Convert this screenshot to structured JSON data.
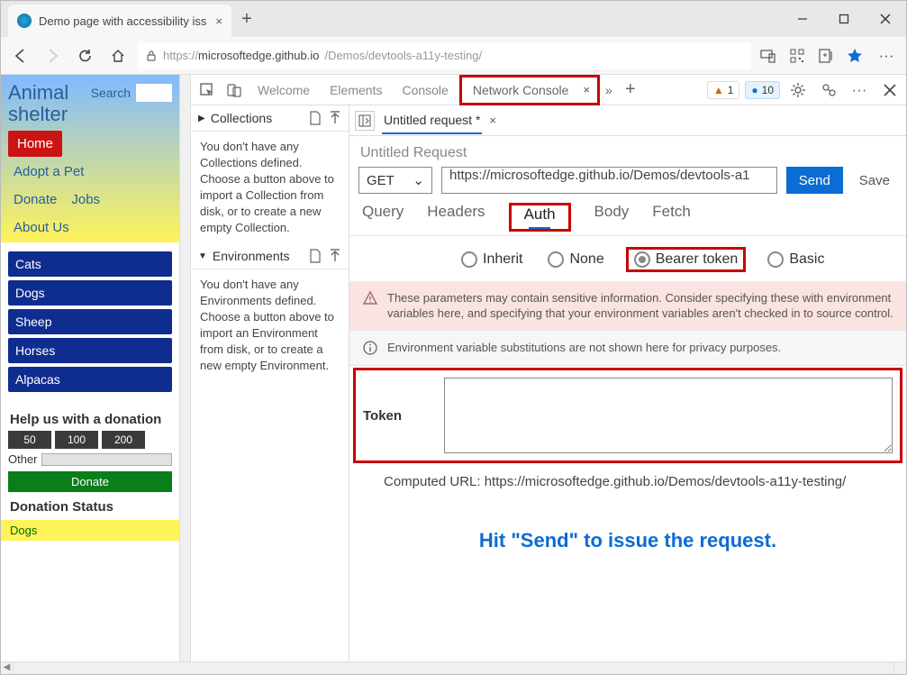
{
  "browser": {
    "tab_title": "Demo page with accessibility iss",
    "url_prefix": "https://",
    "url_domain": "microsoftedge.github.io",
    "url_path": "/Demos/devtools-a11y-testing/"
  },
  "page": {
    "brand_line1": "Animal",
    "brand_line2": "shelter",
    "search_label": "Search",
    "nav": {
      "home": "Home",
      "adopt": "Adopt a Pet",
      "donate": "Donate",
      "jobs": "Jobs",
      "about": "About Us"
    },
    "categories": [
      "Cats",
      "Dogs",
      "Sheep",
      "Horses",
      "Alpacas"
    ],
    "help_title": "Help us with a donation",
    "amounts": [
      "50",
      "100",
      "200"
    ],
    "other_label": "Other",
    "donate_btn": "Donate",
    "status_title": "Donation Status",
    "status_items": [
      "Dogs"
    ]
  },
  "devtools": {
    "tabs": [
      "Welcome",
      "Elements",
      "Console",
      "Network Console"
    ],
    "counts": {
      "error": "1",
      "info": "10"
    },
    "collections": {
      "title": "Collections",
      "help": "You don't have any Collections defined. Choose a button above to import a Collection from disk, or to create a new empty Collection."
    },
    "environments": {
      "title": "Environments",
      "help": "You don't have any Environments defined. Choose a button above to import an Environment from disk, or to create a new empty Environment."
    },
    "request_tab": "Untitled request *",
    "request_title": "Untitled Request",
    "method": "GET",
    "url": "https://microsoftedge.github.io/Demos/devtools-a1",
    "send": "Send",
    "save": "Save",
    "sections": [
      "Query",
      "Headers",
      "Auth",
      "Body",
      "Fetch"
    ],
    "auth_options": [
      "Inherit",
      "None",
      "Bearer token",
      "Basic"
    ],
    "warn_banner": "These parameters may contain sensitive information. Consider specifying these with environment variables here, and specifying that your environment variables aren't checked in to source control.",
    "info_banner": "Environment variable substitutions are not shown here for privacy purposes.",
    "token_label": "Token",
    "computed_label": "Computed URL: ",
    "computed_url": "https://microsoftedge.github.io/Demos/devtools-a11y-testing/",
    "hint": "Hit \"Send\" to issue the request."
  }
}
